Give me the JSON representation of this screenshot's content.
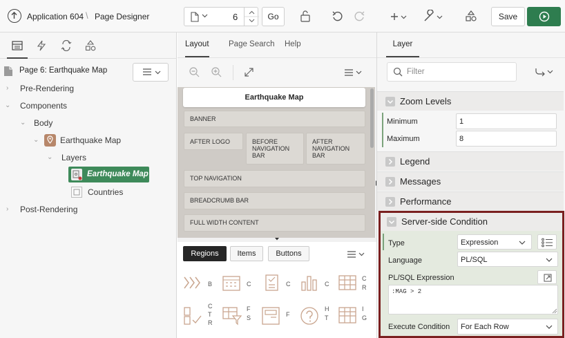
{
  "topbar": {
    "app_label": "Application 604",
    "designer_label": "Page Designer",
    "page_number": "6",
    "go_label": "Go",
    "save_label": "Save"
  },
  "left_pane": {
    "tabs": [
      "rendering-icon",
      "dynamic-actions-icon",
      "processing-icon",
      "shared-components-icon"
    ],
    "page_title": "Page 6: Earthquake Map",
    "tree": {
      "pre_rendering": "Pre-Rendering",
      "components": "Components",
      "body": "Body",
      "region": "Earthquake Map",
      "layers": "Layers",
      "layer_selected": "Earthquake Map",
      "layer_other": "Countries",
      "post_rendering": "Post-Rendering"
    }
  },
  "middle_pane": {
    "tabs": [
      "Layout",
      "Page Search",
      "Help"
    ],
    "page_header": "Earthquake Map",
    "regions": {
      "banner": "BANNER",
      "after_logo": "AFTER LOGO",
      "before_nav_1": "BEFORE",
      "before_nav_2": "NAVIGATION",
      "before_nav_3": "BAR",
      "after_nav_1": "AFTER",
      "after_nav_2": "NAVIGATION",
      "after_nav_3": "BAR",
      "top_nav": "TOP NAVIGATION",
      "breadcrumb": "BREADCRUMB BAR",
      "full_width": "FULL WIDTH CONTENT"
    },
    "gallery_tabs": [
      "Regions",
      "Items",
      "Buttons"
    ],
    "gallery_labels": {
      "r1c1": "B",
      "r1c2": "C",
      "r1c3": "C",
      "r1c4": "C",
      "r1c5a": "C",
      "r1c5b": "R",
      "r2c1a": "C",
      "r2c1b": "T",
      "r2c1c": "R",
      "r2c2a": "F",
      "r2c2b": "S",
      "r2c3": "F",
      "r2c4a": "H",
      "r2c4b": "T",
      "r2c5a": "I",
      "r2c5b": "G"
    }
  },
  "right_pane": {
    "tab": "Layer",
    "filter_placeholder": "Filter",
    "sections": {
      "zoom": "Zoom Levels",
      "legend": "Legend",
      "messages": "Messages",
      "performance": "Performance",
      "condition": "Server-side Condition"
    },
    "zoom": {
      "min_label": "Minimum",
      "min_value": "1",
      "max_label": "Maximum",
      "max_value": "8"
    },
    "condition": {
      "type_label": "Type",
      "type_value": "Expression",
      "language_label": "Language",
      "language_value": "PL/SQL",
      "expr_label": "PL/SQL Expression",
      "expr_value": ":MAG > 2",
      "exec_label": "Execute Condition",
      "exec_value": "For Each Row"
    }
  },
  "colors": {
    "accent_green": "#2e7d4f",
    "highlight_border": "#7a1f1f",
    "selected_node": "#3e8a5a"
  }
}
